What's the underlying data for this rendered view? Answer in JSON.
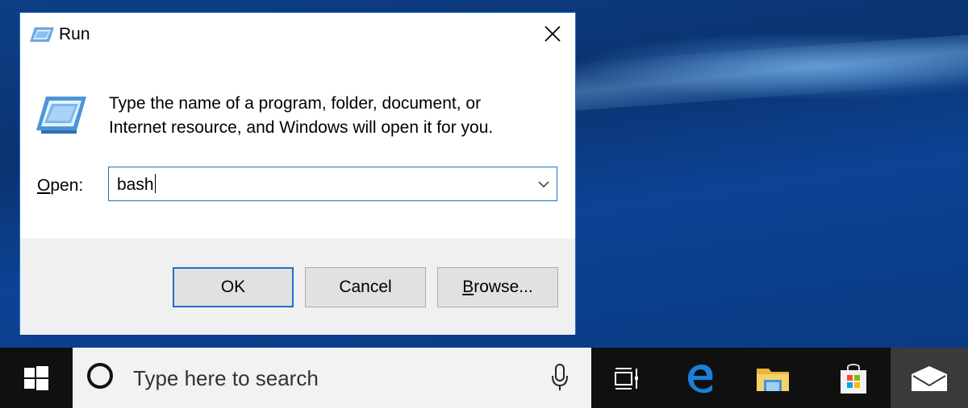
{
  "dialog": {
    "title": "Run",
    "description_line1": "Type the name of a program, folder, document, or",
    "description_line2": "Internet resource, and Windows will open it for you.",
    "open_label_accel": "O",
    "open_label_rest": "pen:",
    "input_value": "bash",
    "buttons": {
      "ok": "OK",
      "cancel": "Cancel",
      "browse_accel": "B",
      "browse_rest": "rowse..."
    }
  },
  "taskbar": {
    "search_placeholder": "Type here to search",
    "apps": [
      "task-view",
      "edge",
      "file-explorer",
      "store",
      "mail"
    ]
  },
  "colors": {
    "accent": "#1f6fc9",
    "taskbar": "#101010",
    "dialog_footer": "#f0f0f0"
  }
}
